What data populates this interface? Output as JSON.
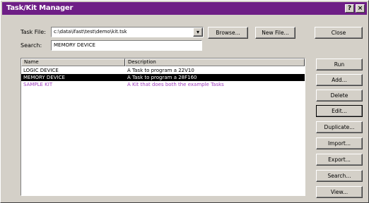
{
  "window": {
    "title": "Task/Kit Manager",
    "help_glyph": "?",
    "close_glyph": "×"
  },
  "task_file": {
    "label": "Task File:",
    "value": "c:\\data\\ifast\\test\\demo\\kit.tsk",
    "dropdown_glyph": "▾"
  },
  "search": {
    "label": "Search:",
    "value": "MEMORY DEVICE"
  },
  "buttons": {
    "browse": "Browse...",
    "new_file": "New File...",
    "close": "Close",
    "run": "Run",
    "add": "Add...",
    "delete": "Delete",
    "edit": "Edit...",
    "duplicate": "Duplicate...",
    "import": "Import...",
    "export": "Export...",
    "search": "Search...",
    "view": "View..."
  },
  "table": {
    "columns": [
      "Name",
      "Description"
    ],
    "rows": [
      {
        "name": "LOGIC DEVICE",
        "description": "A Task to program a 22V10",
        "state": "normal"
      },
      {
        "name": "MEMORY DEVICE",
        "description": "A Task to program a 28F160",
        "state": "selected"
      },
      {
        "name": "SAMPLE KIT",
        "description": "A Kit that does both the example Tasks",
        "state": "kit"
      }
    ]
  },
  "colors": {
    "titlebar": "#6e1e86",
    "selection": "#000000",
    "kit_text": "#a040c0",
    "face": "#d4d0c8"
  }
}
